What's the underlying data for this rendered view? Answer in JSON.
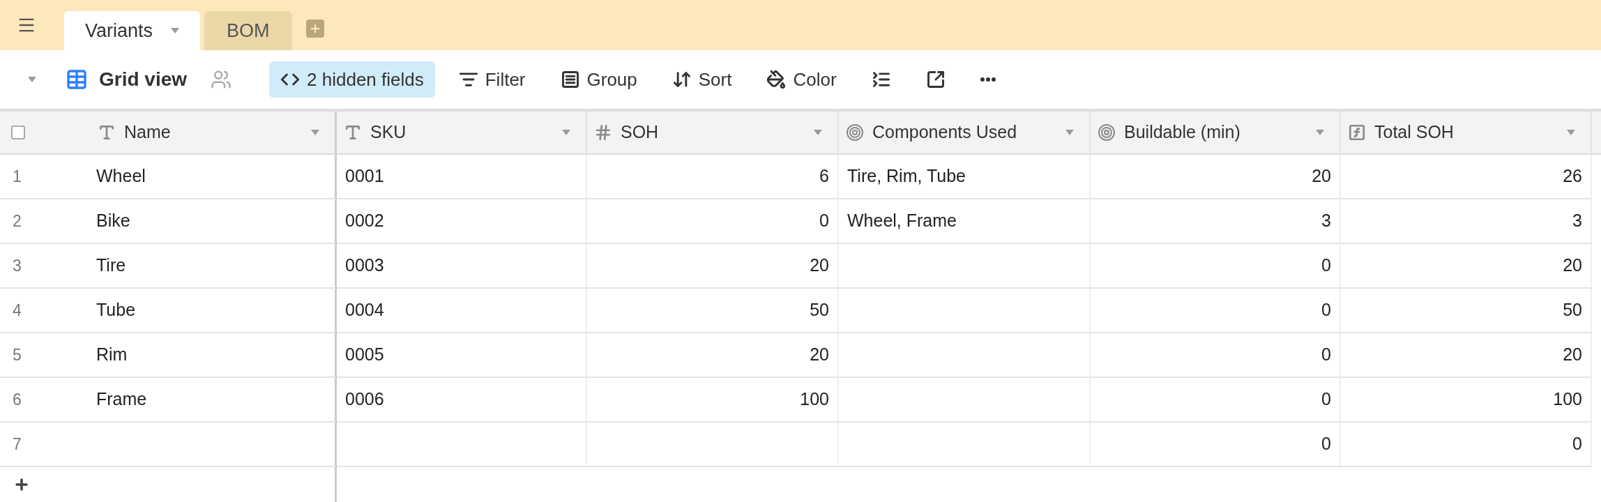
{
  "tabs": [
    {
      "label": "Variants",
      "selected": true
    },
    {
      "label": "BOM",
      "selected": false
    }
  ],
  "toolbar": {
    "view_name": "Grid view",
    "items": [
      {
        "kind": "hidden",
        "label": "2 hidden fields",
        "highlighted": true
      },
      {
        "kind": "filter",
        "label": "Filter",
        "highlighted": false
      },
      {
        "kind": "group",
        "label": "Group",
        "highlighted": false
      },
      {
        "kind": "sort",
        "label": "Sort",
        "highlighted": false
      },
      {
        "kind": "color",
        "label": "Color",
        "highlighted": false
      },
      {
        "kind": "rowheight",
        "highlighted": false
      },
      {
        "kind": "share",
        "highlighted": false
      },
      {
        "kind": "more",
        "highlighted": false
      }
    ]
  },
  "table": {
    "select_all": {
      "checked": false
    },
    "columns": [
      {
        "label": "Name",
        "kind": "text"
      },
      {
        "label": "SKU",
        "kind": "text"
      },
      {
        "label": "SOH",
        "kind": "number"
      },
      {
        "label": "Components Used",
        "kind": "lookup"
      },
      {
        "label": "Buildable (min)",
        "kind": "rollup"
      },
      {
        "label": "Total SOH",
        "kind": "formula"
      }
    ],
    "rows": [
      {
        "number": "1",
        "cells": [
          "Wheel",
          "0001",
          "6",
          "Tire, Rim, Tube",
          "20",
          "26"
        ]
      },
      {
        "number": "2",
        "cells": [
          "Bike",
          "0002",
          "0",
          "Wheel, Frame",
          "3",
          "3"
        ]
      },
      {
        "number": "3",
        "cells": [
          "Tire",
          "0003",
          "20",
          null,
          "0",
          "20"
        ]
      },
      {
        "number": "4",
        "cells": [
          "Tube",
          "0004",
          "50",
          null,
          "0",
          "50"
        ]
      },
      {
        "number": "5",
        "cells": [
          "Rim",
          "0005",
          "20",
          null,
          "0",
          "20"
        ]
      },
      {
        "number": "6",
        "cells": [
          "Frame",
          "0006",
          "100",
          null,
          "0",
          "100"
        ]
      },
      {
        "number": "7",
        "cells": [
          null,
          null,
          null,
          null,
          "0",
          "0"
        ]
      }
    ]
  }
}
